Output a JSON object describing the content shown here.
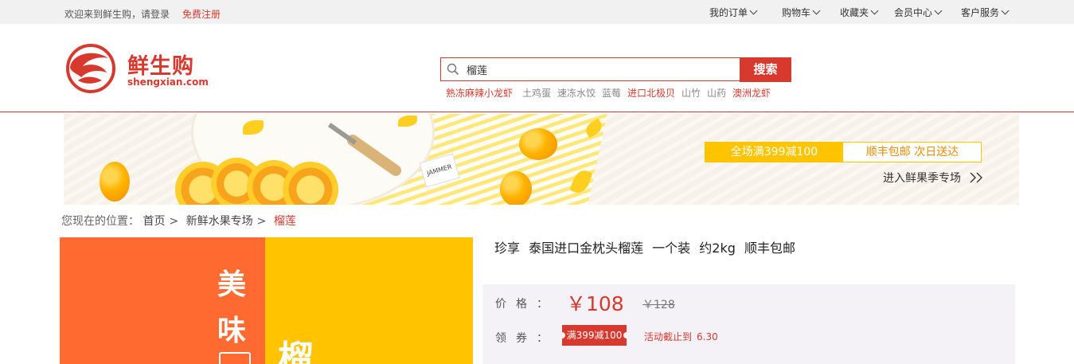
{
  "topbar": {
    "welcome": "欢迎来到鲜生购，请登录",
    "register": "免费注册",
    "nav": [
      {
        "label": "我的订单"
      },
      {
        "label": "购物车"
      },
      {
        "label": "收藏夹"
      },
      {
        "label": "会员中心"
      },
      {
        "label": "客户服务"
      }
    ]
  },
  "header": {
    "logo_name": "鲜生购",
    "logo_domain": "shengxian.com",
    "search": {
      "value": "榴莲",
      "button": "搜索"
    },
    "hot_keywords": [
      {
        "label": "熟冻麻辣小龙虾",
        "highlight": true
      },
      {
        "label": "土鸡蛋",
        "highlight": false
      },
      {
        "label": "速冻水饺",
        "highlight": false
      },
      {
        "label": "蓝莓",
        "highlight": false
      },
      {
        "label": "进口北极贝",
        "highlight": true
      },
      {
        "label": "山竹",
        "highlight": false
      },
      {
        "label": "山药",
        "highlight": false
      },
      {
        "label": "澳洲龙虾",
        "highlight": true
      }
    ]
  },
  "banner": {
    "promo_left": "全场满399减100",
    "promo_right": "顺丰包邮  次日送达",
    "link": "进入鲜果季专场",
    "tag_text": "JAMMER"
  },
  "breadcrumb": {
    "prefix": "您现在的位置：",
    "items": [
      "首页",
      "新鲜水果专场"
    ],
    "current": "榴莲"
  },
  "product": {
    "image_text": [
      "美",
      "味",
      "榴"
    ],
    "title": "珍享  泰国进口金枕头榴莲  一个装  约2kg  顺丰包邮",
    "price_label": "价格：",
    "price_now": "￥108",
    "price_old": "￥128",
    "coupon_label": "领券：",
    "coupon": "满399减100",
    "deadline_label": "活动截止到",
    "deadline_date": "6.30"
  },
  "colors": {
    "brand": "#d8392e",
    "promo_yellow": "#ffc400",
    "image_orange": "#ff6a30",
    "image_yellow": "#ffc300"
  }
}
